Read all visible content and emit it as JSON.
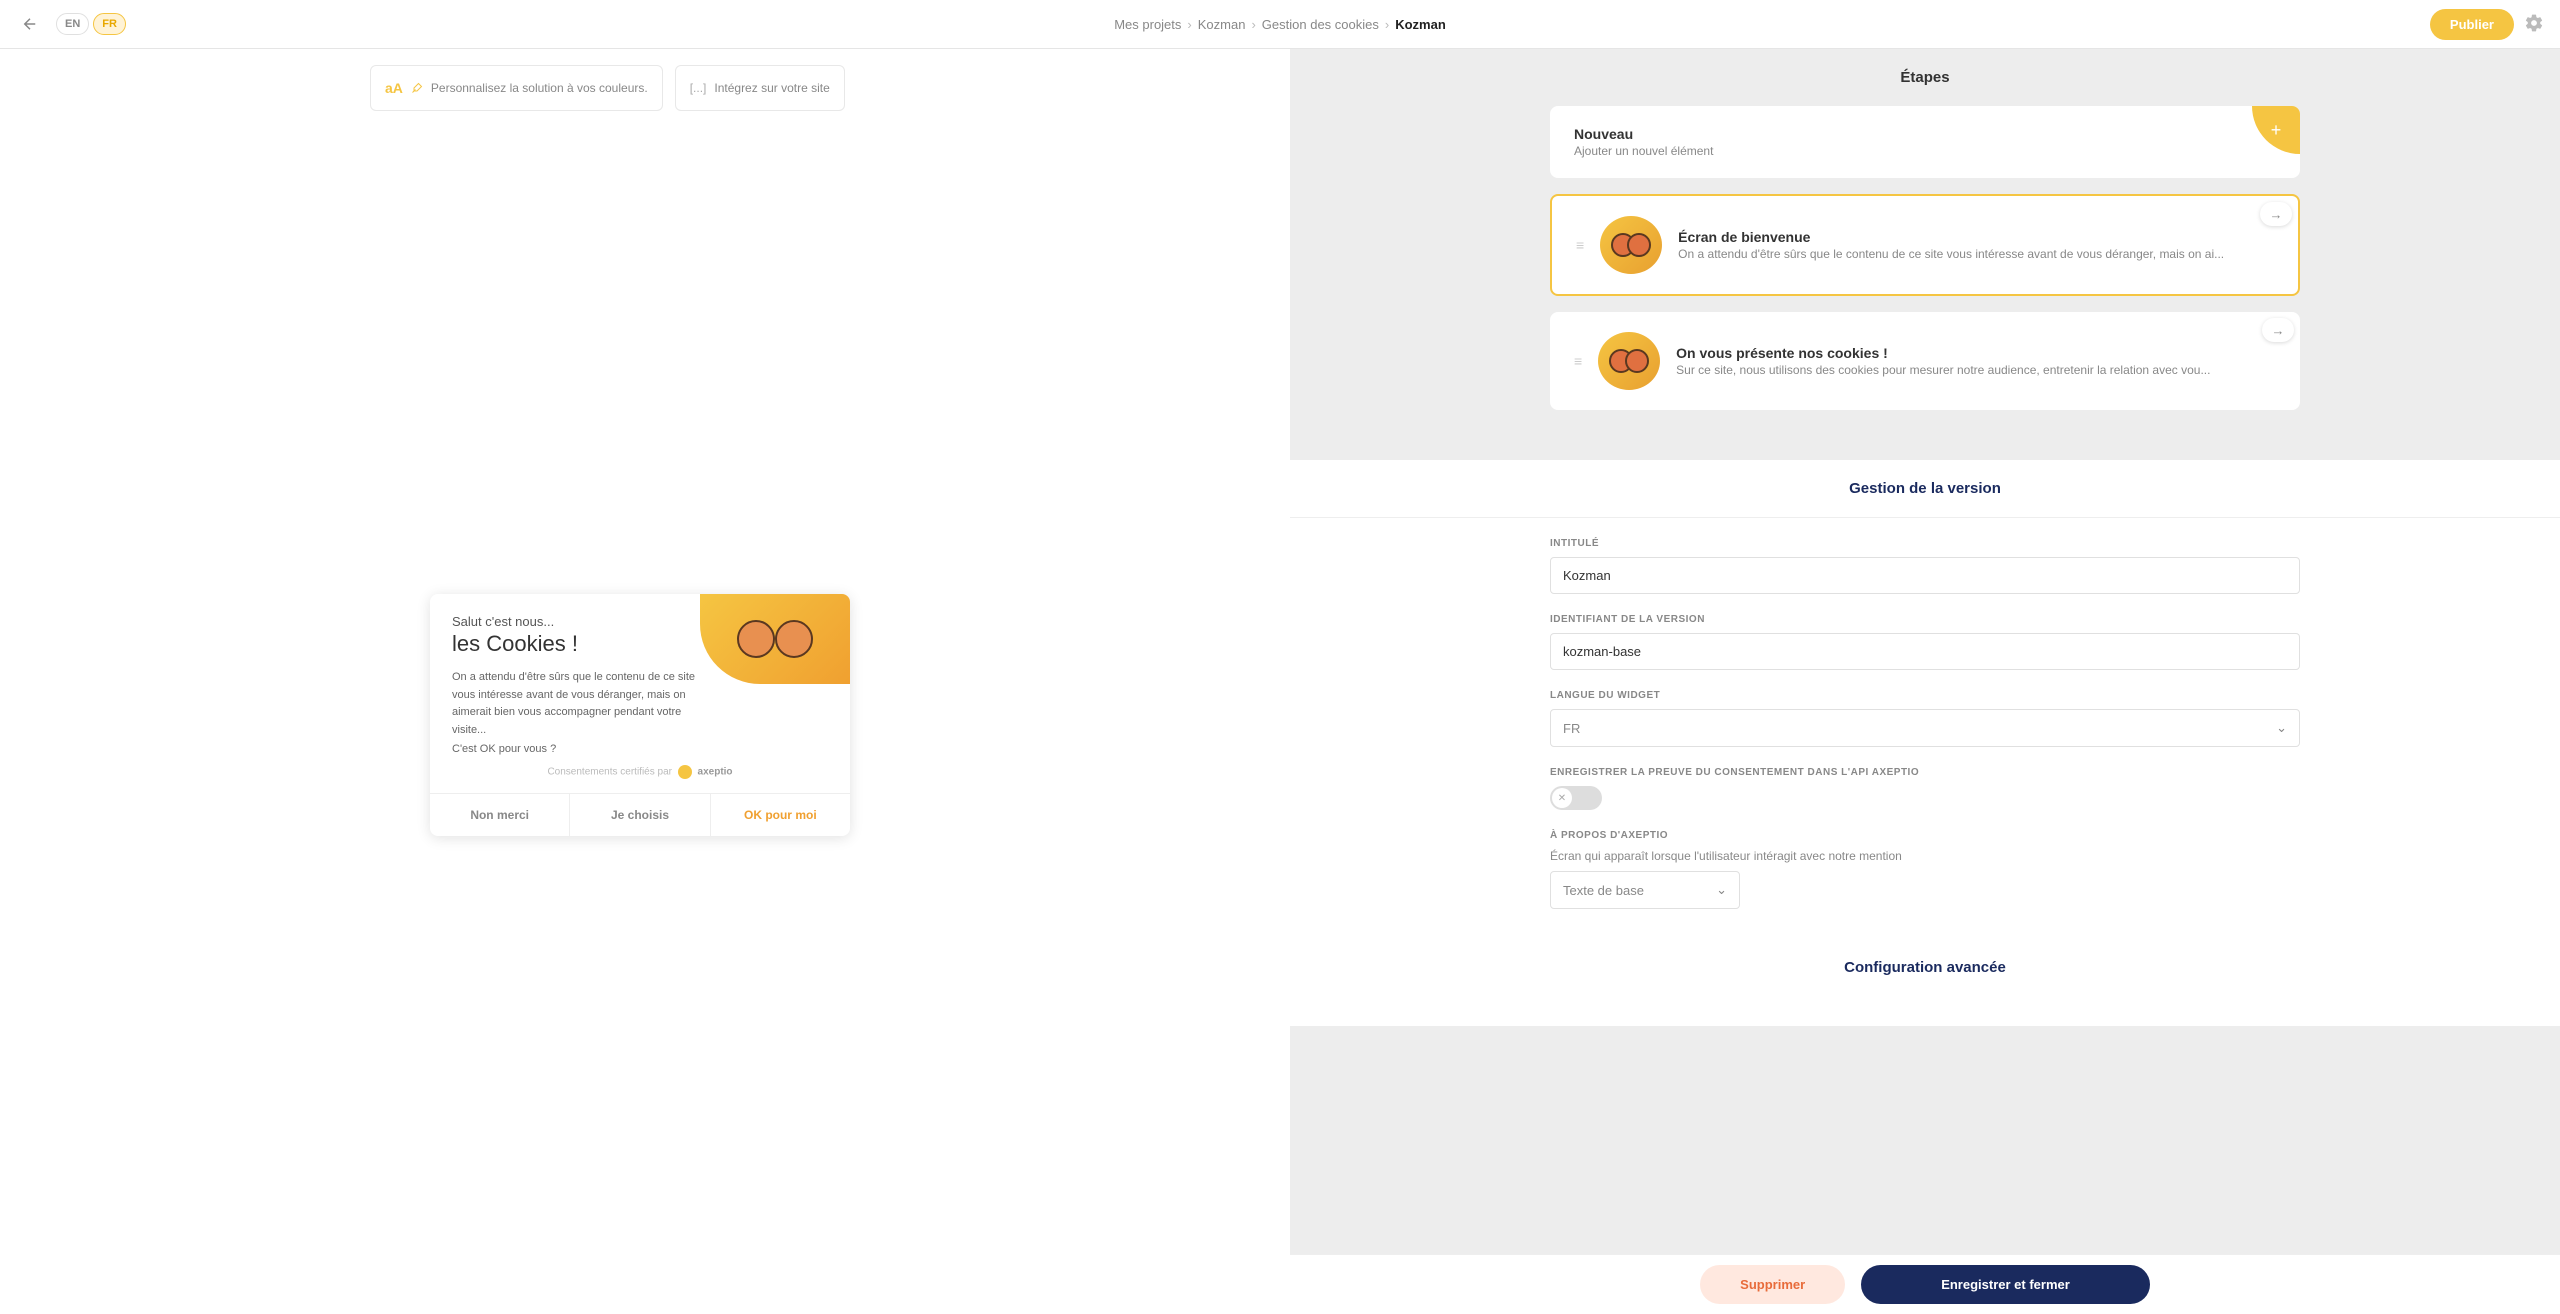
{
  "topbar": {
    "langs": [
      "EN",
      "FR"
    ],
    "active_lang": "FR",
    "breadcrumbs": [
      "Mes projets",
      "Kozman",
      "Gestion des cookies",
      "Kozman"
    ],
    "publish": "Publier"
  },
  "left": {
    "card1": "Personnalisez la solution à vos couleurs.",
    "card1_icon": "aA",
    "card2": "Intégrez sur votre site",
    "card2_icon": "[...]",
    "widget": {
      "sub": "Salut c'est nous...",
      "title": "les Cookies !",
      "text": "On a attendu d'être sûrs que le contenu de ce site vous intéresse avant de vous déranger, mais on aimerait bien vous accompagner pendant votre visite...",
      "question": "C'est OK pour vous ?",
      "cert_prefix": "Consentements certifiés par",
      "cert_brand": "axeptio",
      "btn_no": "Non merci",
      "btn_choose": "Je choisis",
      "btn_ok": "OK pour moi"
    }
  },
  "right": {
    "steps_title": "Étapes",
    "steps": [
      {
        "title": "Nouveau",
        "desc": "Ajouter un nouvel élément",
        "type": "new"
      },
      {
        "title": "Écran de bienvenue",
        "desc": "On a attendu d'être sûrs que le contenu de ce site vous intéresse avant de vous déranger, mais on ai...",
        "type": "active"
      },
      {
        "title": "On vous présente nos cookies !",
        "desc": "Sur ce site, nous utilisons des cookies pour mesurer notre audience, entretenir la relation avec vou...",
        "type": "normal"
      }
    ],
    "version_title": "Gestion de la version",
    "form": {
      "label_title": "Intitulé",
      "value_title": "Kozman",
      "label_id": "Identifiant de la version",
      "value_id": "kozman-base",
      "label_lang": "Langue du widget",
      "value_lang": "FR",
      "label_consent": "Enregistrer la preuve du consentement dans l'API Axeptio",
      "label_about": "À propos d'Axeptio",
      "sub_about": "Écran qui apparaît lorsque l'utilisateur intéragit avec notre mention",
      "value_about": "Texte de base"
    },
    "config_title": "Configuration avancée",
    "footer": {
      "delete": "Supprimer",
      "save": "Enregistrer et fermer"
    }
  }
}
